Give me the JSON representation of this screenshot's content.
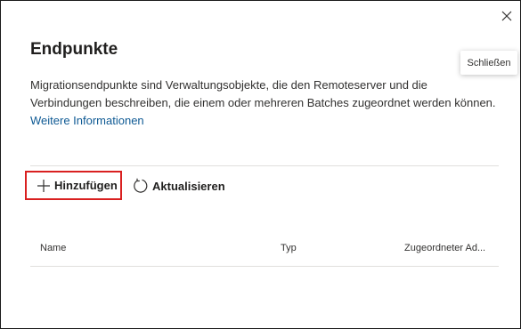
{
  "dialog": {
    "title": "Endpunkte",
    "description": "Migrationsendpunkte sind Verwaltungsobjekte, die den Remoteserver und die Verbindungen beschreiben, die einem oder mehreren Batches zugeordnet werden können.",
    "more_info_link": "Weitere Informationen",
    "close_tooltip": "Schließen"
  },
  "toolbar": {
    "add_label": "Hinzufügen",
    "refresh_label": "Aktualisieren"
  },
  "table": {
    "columns": [
      "Name",
      "Typ",
      "Zugeordneter Ad..."
    ]
  },
  "icons": {
    "close": "close-icon",
    "add": "plus-icon",
    "refresh": "refresh-icon"
  },
  "colors": {
    "link": "#0f5a94",
    "highlight_border": "#d92020"
  }
}
